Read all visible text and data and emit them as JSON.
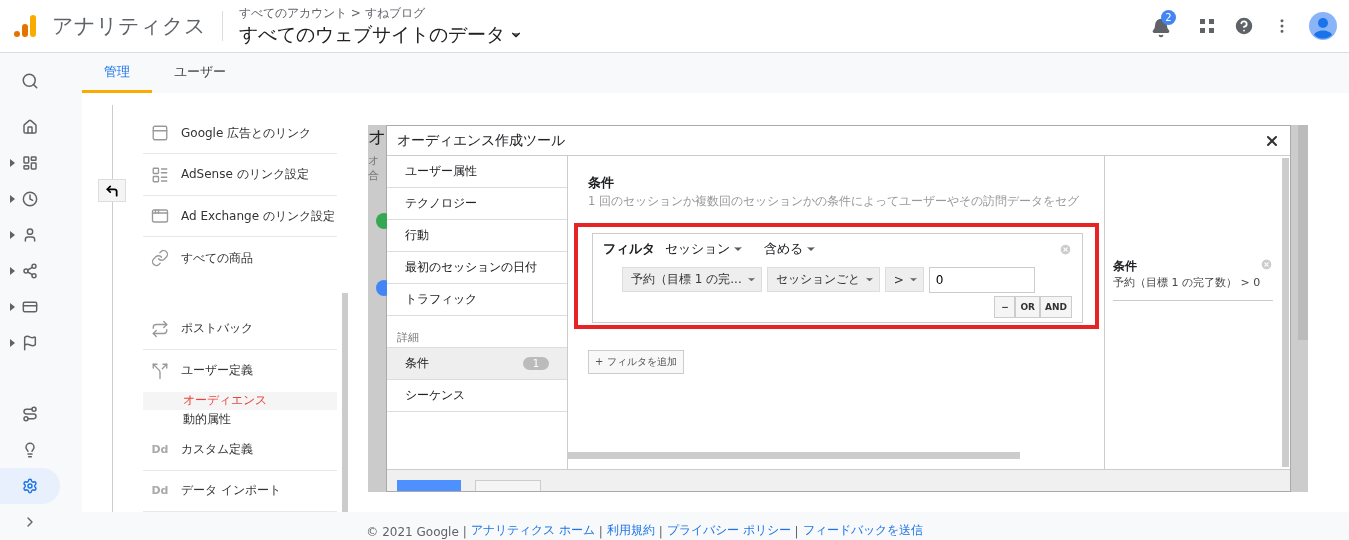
{
  "header": {
    "product": "アナリティクス",
    "breadcrumb": "すべてのアカウント > すねブログ",
    "view": "すべてのウェブサイトのデータ",
    "notifications": "2"
  },
  "tabs": [
    {
      "label": "管理",
      "selected": true
    },
    {
      "label": "ユーザー",
      "selected": false
    }
  ],
  "rail": [
    {
      "kind": "home",
      "expandable": false,
      "selected": false
    },
    {
      "kind": "dashboard",
      "expandable": true,
      "selected": false
    },
    {
      "kind": "clock",
      "expandable": true,
      "selected": false
    },
    {
      "kind": "user",
      "expandable": true,
      "selected": false
    },
    {
      "kind": "flow",
      "expandable": true,
      "selected": false
    },
    {
      "kind": "card",
      "expandable": true,
      "selected": false
    },
    {
      "kind": "flag",
      "expandable": true,
      "selected": false
    },
    {
      "kind": "route",
      "expandable": false,
      "selected": false
    },
    {
      "kind": "bulb",
      "expandable": false,
      "selected": false
    },
    {
      "kind": "gear",
      "expandable": false,
      "selected": true
    }
  ],
  "menu": [
    [
      {
        "kind": "ads",
        "label": "Google 広告とのリンク"
      },
      {
        "kind": "adsense",
        "label": "AdSense のリンク設定"
      },
      {
        "kind": "adx",
        "label": "Ad Exchange のリンク設定"
      },
      {
        "kind": "products",
        "label": "すべての商品"
      }
    ],
    [
      {
        "kind": "postback",
        "label": "ポストバック"
      },
      {
        "kind": "fork",
        "label": "ユーザー定義",
        "children": [
          {
            "label": "オーディエンス",
            "selected": true
          },
          {
            "label": "動的属性",
            "selected": false
          }
        ]
      },
      {
        "kind": "text",
        "icon_text": "Dd",
        "label": "カスタム定義"
      },
      {
        "kind": "text",
        "icon_text": "Dd",
        "label": "データ インポート"
      }
    ]
  ],
  "backdrop": {
    "title": "オ",
    "lines": [
      "オ",
      "合"
    ]
  },
  "modal": {
    "title": "オーディエンス作成ツール",
    "nav": [
      {
        "kind": "item",
        "label": "ユーザー属性",
        "selected": false
      },
      {
        "kind": "item",
        "label": "テクノロジー",
        "selected": false
      },
      {
        "kind": "item",
        "label": "行動",
        "selected": false
      },
      {
        "kind": "item",
        "label": "最初のセッションの日付",
        "selected": false
      },
      {
        "kind": "item",
        "label": "トラフィック",
        "selected": false
      },
      {
        "kind": "heading",
        "label": "詳細"
      },
      {
        "kind": "item",
        "label": "条件",
        "count": "1",
        "selected": true
      },
      {
        "kind": "item",
        "label": "シーケンス",
        "selected": false
      }
    ],
    "section_title": "条件",
    "description": "1 回のセッションか複数回のセッションかの条件によってユーザーやその訪問データをセグ",
    "filter": {
      "label": "フィルタ",
      "scope": "セッション",
      "mode": "含める",
      "metric": "予約（目標 1 の完...",
      "per": "セッションごと",
      "operator": ">",
      "value": "0",
      "buttons": [
        "−",
        "OR",
        "AND"
      ]
    },
    "add_filter": "+ フィルタを追加",
    "summary": {
      "title": "条件",
      "text": "予約（目標 1 の完了数） > 0"
    }
  },
  "footer": {
    "copyright": "© 2021 Google",
    "separator": "|",
    "links": [
      "アナリティクス ホーム",
      "利用規約",
      "プライバシー ポリシー",
      "フィードバックを送信"
    ]
  }
}
